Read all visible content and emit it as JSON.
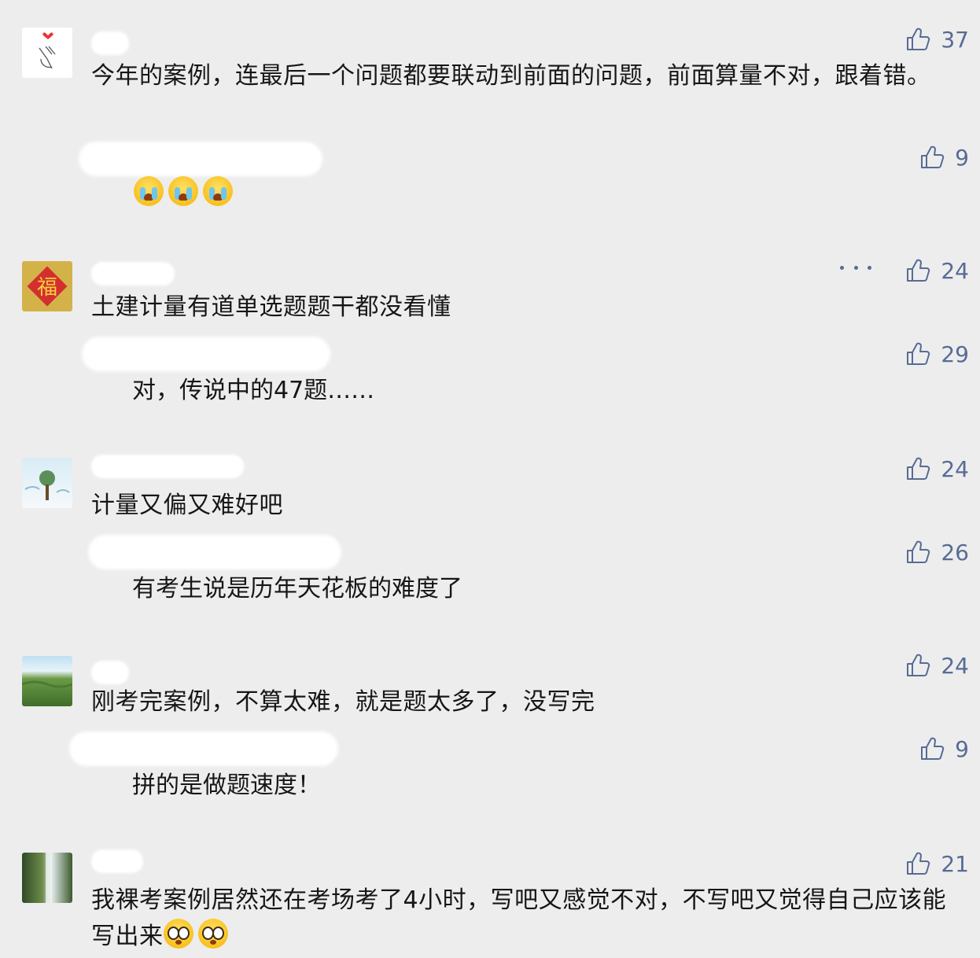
{
  "comments": [
    {
      "avatar": "heart-hand-avatar",
      "text": "今年的案例，连最后一个问题都要联动到前面的问题，前面算量不对，跟着错。",
      "likes": "37",
      "reply": {
        "text": "",
        "emojis": [
          "crying-face",
          "crying-face",
          "crying-face"
        ],
        "likes": "9"
      }
    },
    {
      "avatar": "fu-character-avatar",
      "text": "土建计量有道单选题题干都没看懂",
      "likes": "24",
      "reply": {
        "text": "对，传说中的47题……",
        "likes": "29"
      }
    },
    {
      "avatar": "tree-painting-avatar",
      "text": "计量又偏又难好吧",
      "likes": "24",
      "reply": {
        "text": "有考生说是历年天花板的难度了",
        "likes": "26"
      }
    },
    {
      "avatar": "grassland-avatar",
      "text": "刚考完案例，不算太难，就是题太多了，没写完",
      "likes": "24",
      "reply": {
        "text": "拼的是做题速度！",
        "likes": "9"
      }
    },
    {
      "avatar": "waterfall-avatar",
      "text": "我裸考案例居然还在考场考了4小时，写吧又感觉不对，不写吧又觉得自己应该能写出来",
      "emojis": [
        "flushed-face",
        "flushed-face"
      ],
      "likes": "21"
    }
  ],
  "colors": {
    "background": "#ededed",
    "like": "#576b95",
    "text": "#161616"
  }
}
